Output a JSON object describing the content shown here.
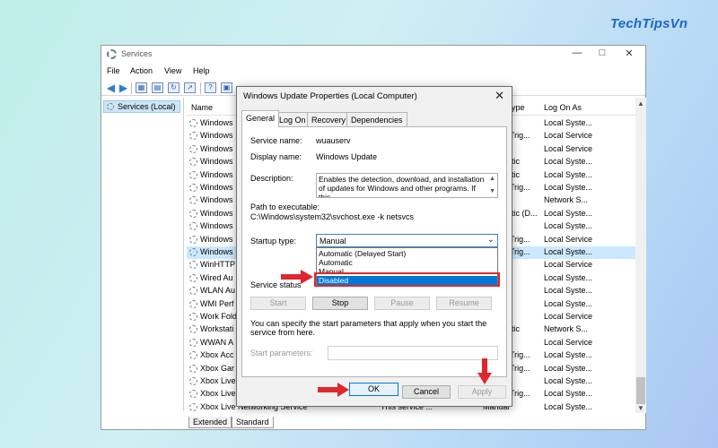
{
  "brand": "TechTipsVn",
  "window": {
    "title": "Services",
    "menu": [
      "File",
      "Action",
      "View",
      "Help"
    ],
    "tree_label": "Services (Local)"
  },
  "list": {
    "headers": {
      "name": "Name",
      "type": "Type",
      "logon": "Log On As"
    },
    "rows": [
      {
        "name": "Windows",
        "type": "",
        "logon": "Local Syste..."
      },
      {
        "name": "Windows",
        "type": "(Trig...",
        "logon": "Local Service"
      },
      {
        "name": "Windows",
        "type": "",
        "logon": "Local Service"
      },
      {
        "name": "Windows",
        "type": "atic",
        "logon": "Local Syste..."
      },
      {
        "name": "Windows",
        "type": "atic",
        "logon": "Local Syste..."
      },
      {
        "name": "Windows",
        "type": "(Trig...",
        "logon": "Local Syste..."
      },
      {
        "name": "Windows",
        "type": "",
        "logon": "Network S..."
      },
      {
        "name": "Windows",
        "type": "atic (D...",
        "logon": "Local Syste..."
      },
      {
        "name": "Windows",
        "type": "",
        "logon": "Local Syste..."
      },
      {
        "name": "Windows",
        "type": "(Trig...",
        "logon": "Local Service"
      },
      {
        "name": "Windows",
        "type": "(Trig...",
        "logon": "Local Syste..."
      },
      {
        "name": "WinHTTP",
        "type": "",
        "logon": "Local Service"
      },
      {
        "name": "Wired Au",
        "type": "",
        "logon": "Local Syste..."
      },
      {
        "name": "WLAN Au",
        "type": "",
        "logon": "Local Syste..."
      },
      {
        "name": "WMI Perf",
        "type": "",
        "logon": "Local Syste..."
      },
      {
        "name": "Work Fold",
        "type": "",
        "logon": "Local Service"
      },
      {
        "name": "Workstati",
        "type": "atic",
        "logon": "Network S..."
      },
      {
        "name": "WWAN A",
        "type": "",
        "logon": "Local Service"
      },
      {
        "name": "Xbox Acc",
        "type": "(Trig...",
        "logon": "Local Syste..."
      },
      {
        "name": "Xbox Gar",
        "type": "(Trig...",
        "logon": "Local Syste..."
      },
      {
        "name": "Xbox Live",
        "type": "",
        "logon": "Local Syste..."
      },
      {
        "name": "Xbox Live",
        "type": "(Trig...",
        "logon": "Local Syste..."
      }
    ],
    "last_row": {
      "name": "Xbox Live Networking Service",
      "desc": "This service ...",
      "type": "Manual",
      "logon": "Local Syste..."
    },
    "bottom_tabs": [
      "Extended",
      "Standard"
    ]
  },
  "dialog": {
    "title": "Windows Update Properties (Local Computer)",
    "tabs": [
      "General",
      "Log On",
      "Recovery",
      "Dependencies"
    ],
    "service_name_label": "Service name:",
    "service_name": "wuauserv",
    "display_name_label": "Display name:",
    "display_name": "Windows Update",
    "description_label": "Description:",
    "description": "Enables the detection, download, and installation of updates for Windows and other programs. If this",
    "path_label": "Path to executable:",
    "path": "C:\\Windows\\system32\\svchost.exe -k netsvcs",
    "startup_label": "Startup type:",
    "startup_value": "Manual",
    "startup_options": [
      "Automatic (Delayed Start)",
      "Automatic",
      "Manual",
      "Disabled"
    ],
    "service_status_label": "Service status",
    "buttons": {
      "start": "Start",
      "stop": "Stop",
      "pause": "Pause",
      "resume": "Resume"
    },
    "params_note": "You can specify the start parameters that apply when you start the service from here.",
    "params_label": "Start parameters:",
    "ok": "OK",
    "cancel": "Cancel",
    "apply": "Apply"
  },
  "colors": {
    "annotation": "#e0262d",
    "selection": "#0078d7",
    "brand": "#1d67c9"
  }
}
